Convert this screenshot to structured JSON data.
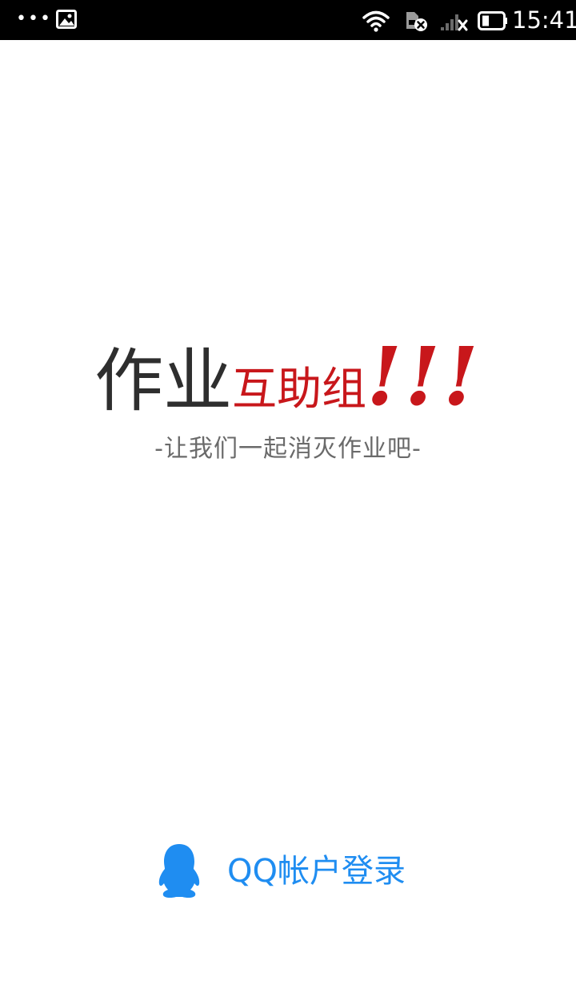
{
  "status_bar": {
    "time": "15:41",
    "icons": [
      "more-dots-icon",
      "image-notification-icon",
      "wifi-icon",
      "sim-error-icon",
      "signal-no-service-icon",
      "battery-icon"
    ]
  },
  "logo": {
    "part1": "作业",
    "part2": "互助组",
    "part3": "!!!",
    "colors": {
      "dark": "#2e2e2e",
      "accent": "#c8171b"
    }
  },
  "slogan": "-让我们一起消灭作业吧-",
  "login": {
    "label": "QQ帐户登录",
    "icon": "qq-penguin-icon",
    "color": "#1f8df1"
  }
}
